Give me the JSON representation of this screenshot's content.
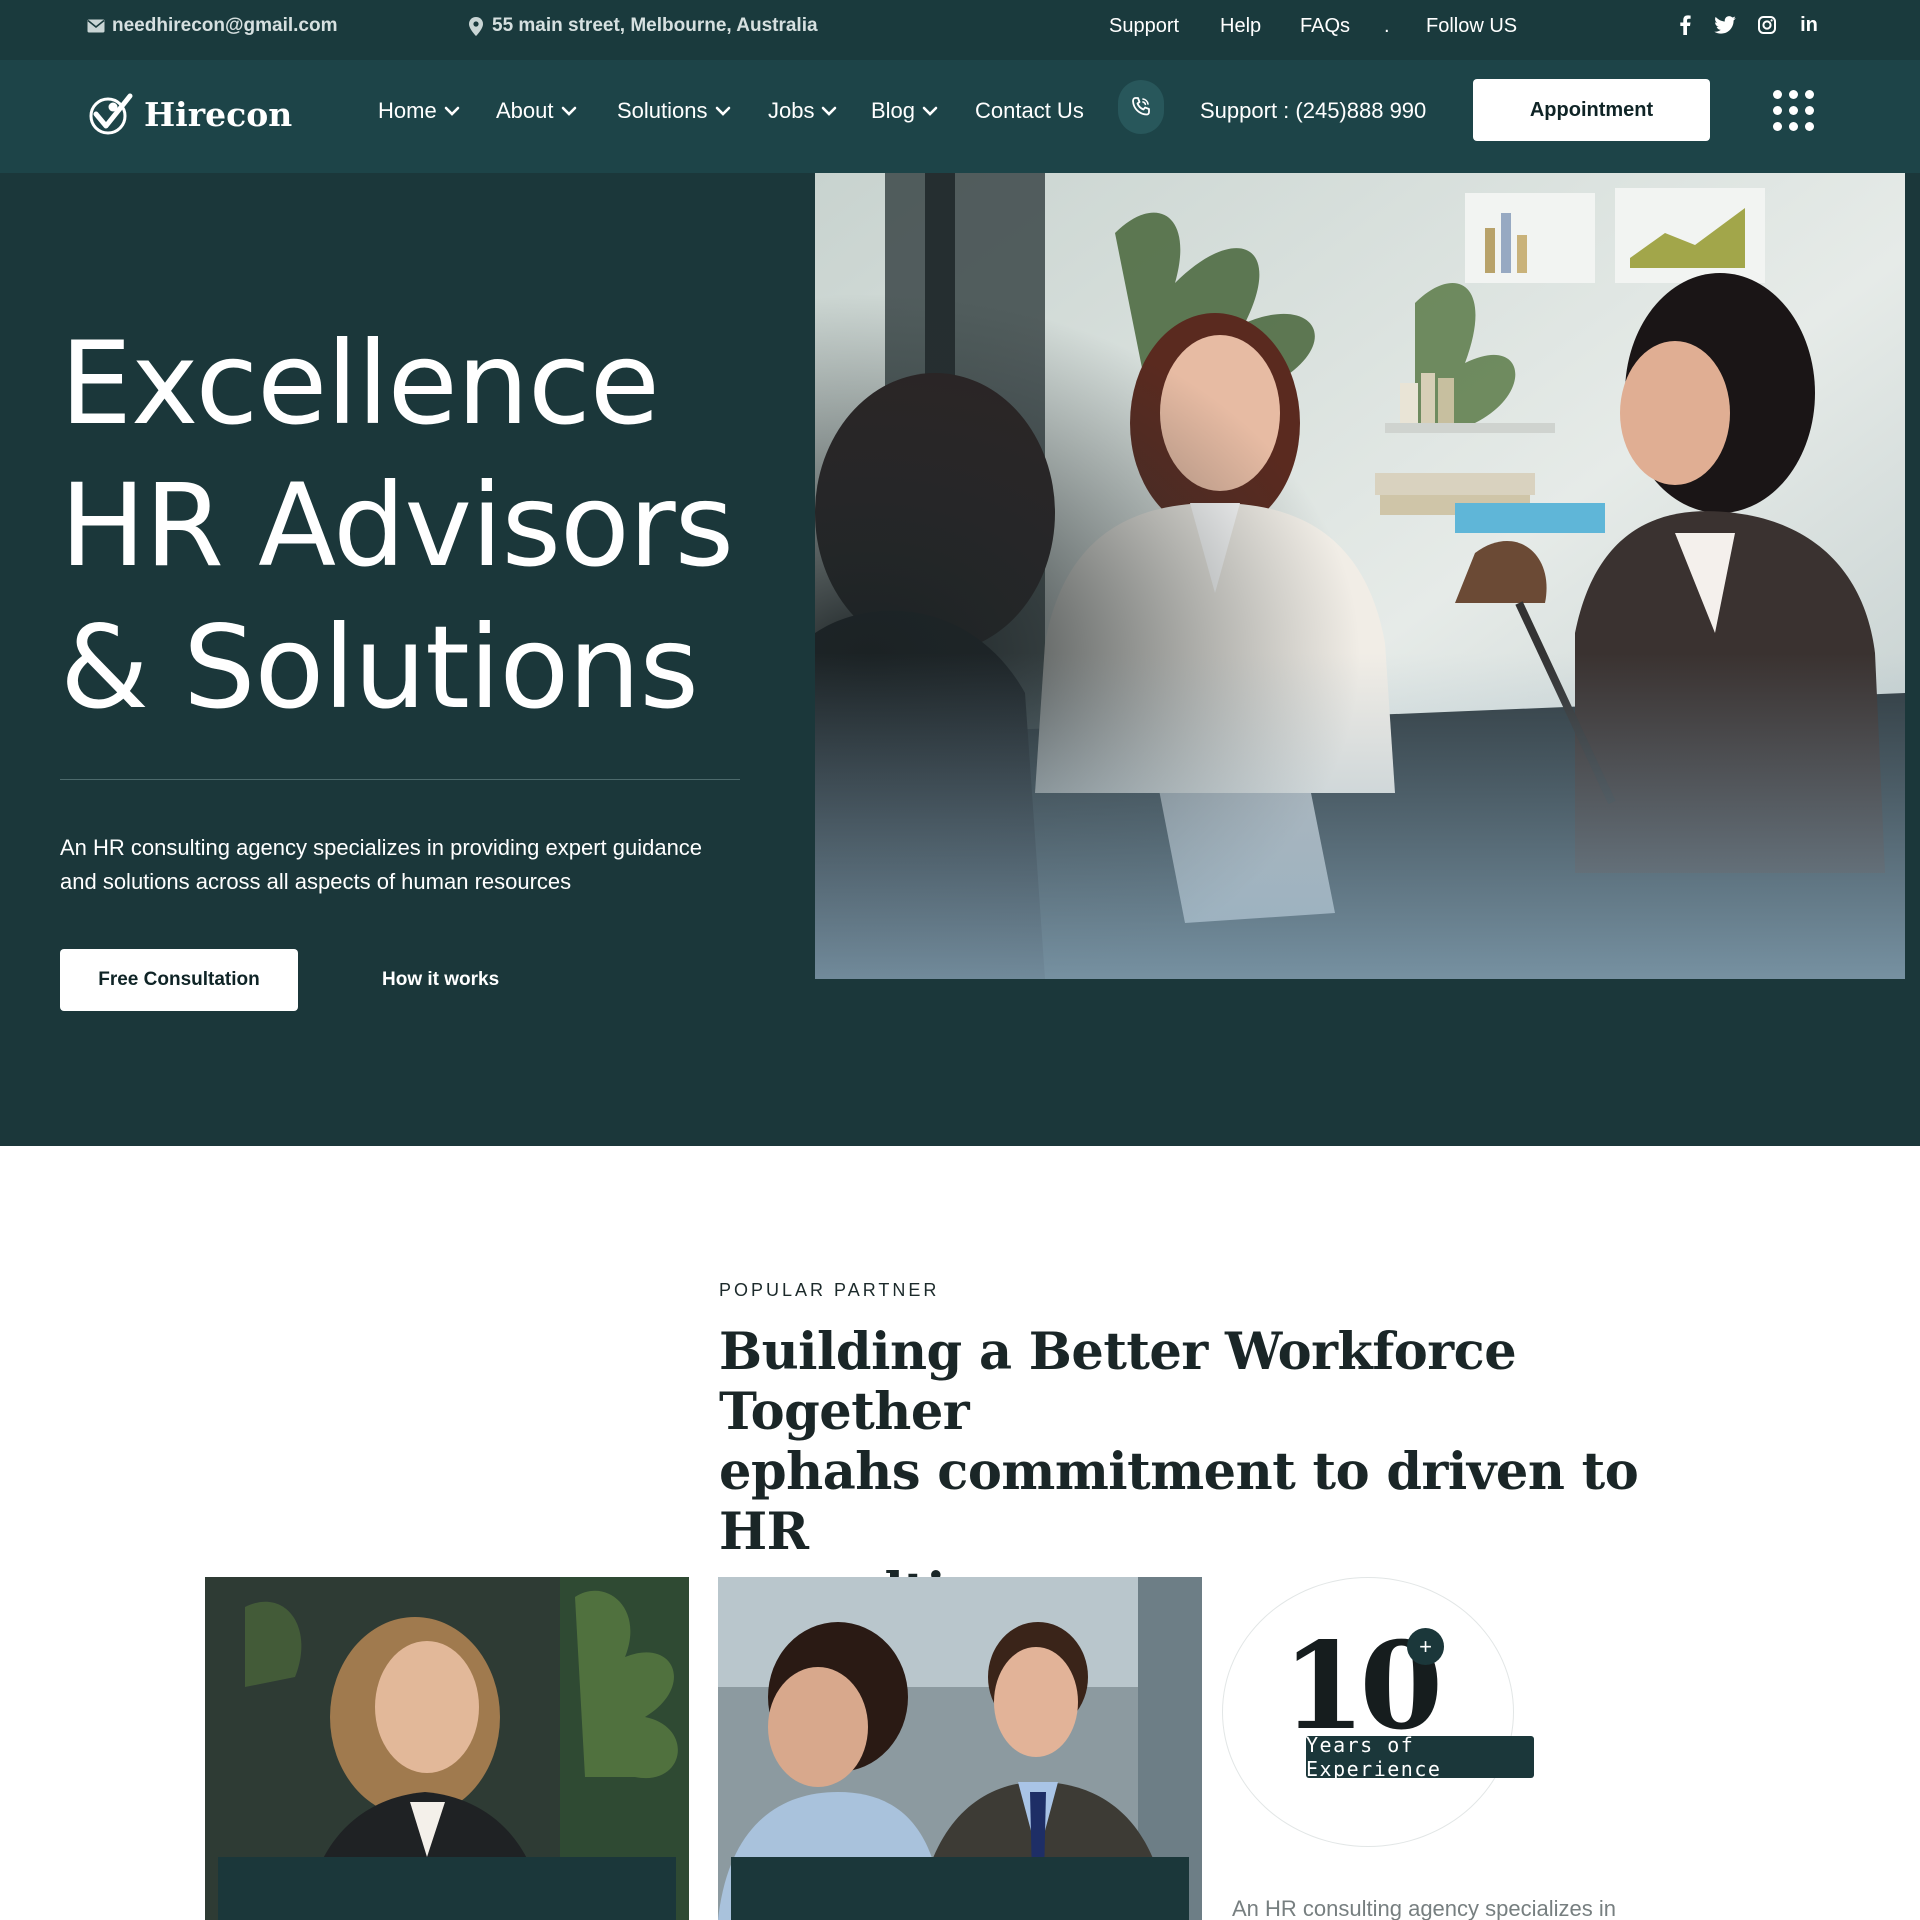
{
  "topbar": {
    "email": "needhirecon@gmail.com",
    "address": "55 main street, Melbourne, Australia",
    "links": [
      "Support",
      "Help",
      "FAQs"
    ],
    "separator": ".",
    "follow_label": "Follow US",
    "social": [
      "facebook-icon",
      "twitter-icon",
      "instagram-icon",
      "linkedin-icon"
    ],
    "linkedin_glyph": "in"
  },
  "nav": {
    "logo_text": "Hirecon",
    "items": [
      {
        "label": "Home",
        "dropdown": true
      },
      {
        "label": "About",
        "dropdown": true
      },
      {
        "label": "Solutions",
        "dropdown": true
      },
      {
        "label": "Jobs",
        "dropdown": true
      },
      {
        "label": "Blog",
        "dropdown": true
      },
      {
        "label": "Contact Us",
        "dropdown": false
      }
    ],
    "support_phone": "Support : (245)888 990",
    "appointment_label": "Appointment"
  },
  "hero": {
    "title_lines": [
      "Excellence",
      "HR Advisors",
      "& Solutions"
    ],
    "description_line1": "An HR consulting agency specializes in providing expert guidance",
    "description_line2": "and solutions across all aspects of human resources",
    "primary_button": "Free Consultation",
    "secondary_link": "How it works"
  },
  "partner": {
    "eyebrow": "POPULAR PARTNER",
    "heading_line1": "Building a Better Workforce Together",
    "heading_line2": "ephahs commitment to driven to HR",
    "heading_line3": "consulting.",
    "experience_number": "10",
    "experience_plus": "+",
    "experience_label": "Years of Experience",
    "tail_text": "An HR consulting agency specializes in"
  },
  "colors": {
    "topbar_bg": "#1a3a3d",
    "navbar_bg": "#1d4448",
    "hero_bg": "#1b373a",
    "accent_white": "#ffffff"
  }
}
